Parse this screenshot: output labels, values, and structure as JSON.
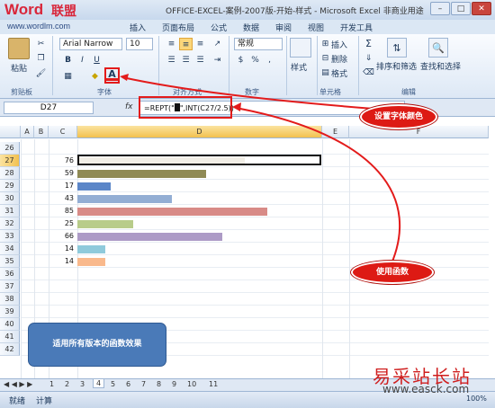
{
  "window": {
    "title": "OFFICE-EXCEL-案例-2007版-开始-样式 - Microsoft Excel 非商业用途",
    "minimize": "–",
    "maximize": "□",
    "close": "✕"
  },
  "logo": {
    "word": "Word",
    "cn": "联盟",
    "url": "www.wordlm.com"
  },
  "ribbon_tabs": [
    "插入",
    "页面布局",
    "公式",
    "数据",
    "审阅",
    "视图",
    "开发工具"
  ],
  "ribbon": {
    "paste": "粘贴",
    "font_name": "Arial Narrow",
    "font_size": "10",
    "number_format": "常规",
    "style": "样式",
    "insert": "插入",
    "delete": "删除",
    "format": "格式",
    "sort_filter": "排序和筛选",
    "find_select": "查找和选择",
    "bold": "B",
    "italic": "I",
    "underline": "U",
    "font_color_letter": "A",
    "percent": "%",
    "comma": ",",
    "currency": "$",
    "sigma": "Σ"
  },
  "groups": [
    "剪贴板",
    "字体",
    "对齐方式",
    "数字",
    "单元格",
    "编辑"
  ],
  "formula_bar": {
    "name_box": "D27",
    "fx": "fx",
    "formula_prefix": "=REPT(\"",
    "formula_suffix": "\",INT(C27/2.5))"
  },
  "columns": [
    "A",
    "B",
    "C",
    "D",
    "E",
    "F"
  ],
  "rows": [
    {
      "num": "26",
      "value": ""
    },
    {
      "num": "27",
      "value": "76"
    },
    {
      "num": "28",
      "value": "59"
    },
    {
      "num": "29",
      "value": "17"
    },
    {
      "num": "30",
      "value": "43"
    },
    {
      "num": "31",
      "value": "85"
    },
    {
      "num": "32",
      "value": "25"
    },
    {
      "num": "33",
      "value": "66"
    },
    {
      "num": "34",
      "value": "14"
    },
    {
      "num": "35",
      "value": "14"
    },
    {
      "num": "36",
      "value": ""
    },
    {
      "num": "37",
      "value": ""
    },
    {
      "num": "38",
      "value": ""
    },
    {
      "num": "39",
      "value": ""
    },
    {
      "num": "40",
      "value": ""
    },
    {
      "num": "41",
      "value": ""
    },
    {
      "num": "42",
      "value": ""
    }
  ],
  "bars": [
    {
      "value": 76,
      "color": "#f1eee6"
    },
    {
      "value": 59,
      "color": "#8f8a55"
    },
    {
      "value": 17,
      "color": "#5b86c8"
    },
    {
      "value": 43,
      "color": "#93aed4"
    },
    {
      "value": 85,
      "color": "#d88b87"
    },
    {
      "value": 25,
      "color": "#b8cc8a"
    },
    {
      "value": 66,
      "color": "#ad9bc6"
    },
    {
      "value": 14,
      "color": "#8fcadb"
    },
    {
      "value": 14,
      "color": "#f9b98c"
    }
  ],
  "annotations": {
    "font_color": "设置字体颜色",
    "use_function": "使用函数",
    "note": "适用所有版本的函数效果"
  },
  "sheet_tabs": [
    "1",
    "2",
    "3",
    "4",
    "5",
    "6",
    "7",
    "8",
    "9",
    "10",
    "11"
  ],
  "status": {
    "ready": "就绪",
    "calc": "计算",
    "zoom": "100%"
  },
  "watermark": {
    "cn": "易采站长站",
    "url": "www.easck.com"
  }
}
